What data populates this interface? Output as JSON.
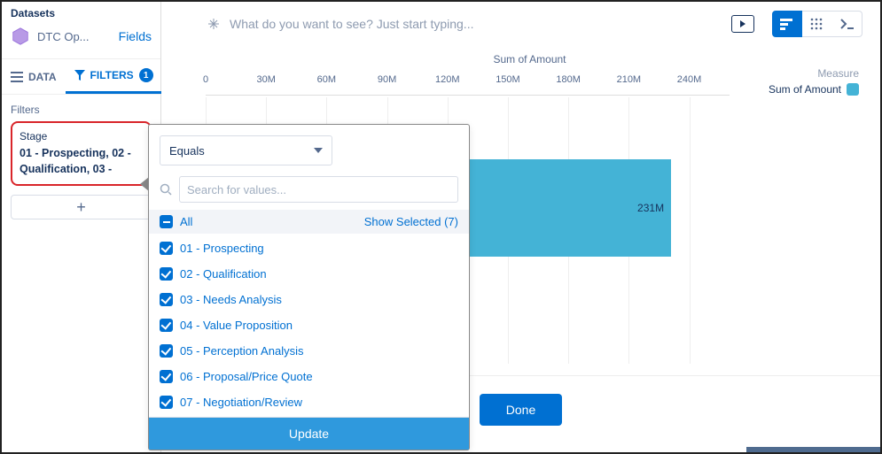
{
  "colors": {
    "accent": "#0070d2",
    "bar": "#44b3d6"
  },
  "left": {
    "datasets_label": "Datasets",
    "dataset_name": "DTC Op...",
    "fields_label": "Fields",
    "tabs": {
      "data": "DATA",
      "filters": "FILTERS",
      "filters_count": "1"
    },
    "filters_section_label": "Filters",
    "filter_card": {
      "field": "Stage",
      "value": "01 - Prospecting, 02 - Qualification, 03 -"
    },
    "add_label": "+"
  },
  "search": {
    "placeholder": "What do you want to see? Just start typing..."
  },
  "chart_data": {
    "type": "bar",
    "title": "Sum of Amount",
    "categories": [
      ""
    ],
    "values": [
      231
    ],
    "value_labels": [
      "231M"
    ],
    "xlim": [
      0,
      260
    ],
    "ticks": [
      0,
      30,
      60,
      90,
      120,
      150,
      180,
      210,
      240
    ],
    "tick_labels": [
      "0",
      "30M",
      "60M",
      "90M",
      "120M",
      "150M",
      "180M",
      "210M",
      "240M"
    ],
    "legend": "Sum of Amount",
    "measure_label": "Measure"
  },
  "popover": {
    "operator": "Equals",
    "search_placeholder": "Search for values...",
    "all_label": "All",
    "show_selected": "Show Selected (7)",
    "items": [
      "01 - Prospecting",
      "02 - Qualification",
      "03 - Needs Analysis",
      "04 - Value Proposition",
      "05 - Perception Analysis",
      "06 - Proposal/Price Quote",
      "07 - Negotiation/Review"
    ],
    "update_label": "Update"
  },
  "done_label": "Done"
}
